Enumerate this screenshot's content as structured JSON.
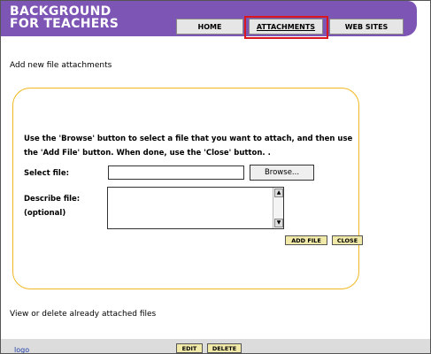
{
  "header": {
    "logo_line1": "BACKGROUND",
    "logo_line2": "FOR TEACHERS",
    "nav": [
      {
        "label": "HOME"
      },
      {
        "label": "ATTACHMENTS"
      },
      {
        "label": "WEB SITES"
      }
    ]
  },
  "page": {
    "add_heading": "Add new file attachments",
    "instructions": "Use the 'Browse' button to select a file that you want to attach, and then use the 'Add File' button. When done, use the 'Close' button. .",
    "select_file_label": "Select file:",
    "browse_label": "Browse...",
    "describe_label_line1": "Describe file:",
    "describe_label_line2": "(optional)",
    "add_file_button": "ADD FILE",
    "close_button": "CLOSE",
    "view_heading": "View or delete already attached files"
  },
  "attachments": [
    {
      "name": "logo",
      "edit": "EDIT",
      "delete": "DELETE"
    }
  ],
  "colors": {
    "header": "#7d55b5",
    "highlight": "#d8181e",
    "box_border": "#f0b820",
    "button": "#f1e9a8"
  }
}
